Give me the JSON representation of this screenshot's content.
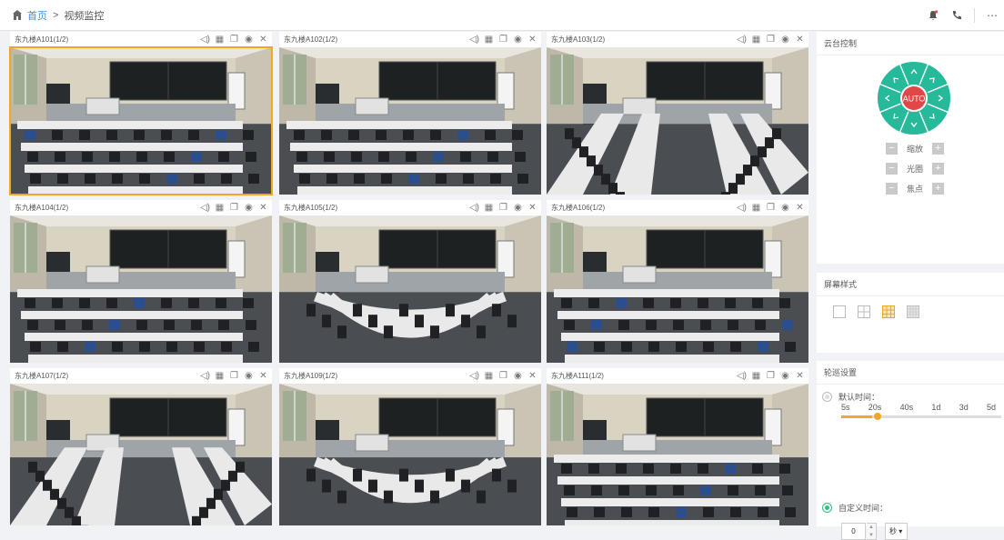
{
  "breadcrumb": {
    "home": "首页",
    "separator": ">",
    "current": "视频监控"
  },
  "topbar_icons": [
    "bell-icon",
    "phone-icon",
    "more-icon"
  ],
  "cameras": [
    {
      "name": "东九楼A101(1/2)",
      "active": true,
      "scene": "rows"
    },
    {
      "name": "东九楼A102(1/2)",
      "active": false,
      "scene": "rows"
    },
    {
      "name": "东九楼A103(1/2)",
      "active": false,
      "scene": "aisle"
    },
    {
      "name": "东九楼A104(1/2)",
      "active": false,
      "scene": "rows"
    },
    {
      "name": "东九楼A105(1/2)",
      "active": false,
      "scene": "arc"
    },
    {
      "name": "东九楼A106(1/2)",
      "active": false,
      "scene": "rows"
    },
    {
      "name": "东九楼A107(1/2)",
      "active": false,
      "scene": "aisle"
    },
    {
      "name": "东九楼A109(1/2)",
      "active": false,
      "scene": "arc"
    },
    {
      "name": "东九楼A111(1/2)",
      "active": false,
      "scene": "rows"
    }
  ],
  "cell_tool_icons": [
    "volume-icon",
    "snapshot-icon",
    "copy-icon",
    "record-icon",
    "close-icon"
  ],
  "ptz": {
    "title": "云台控制",
    "center_label": "AUTO",
    "rows": [
      {
        "label": "缩放",
        "minus": "−",
        "plus": "+"
      },
      {
        "label": "光圈",
        "minus": "−",
        "plus": "+"
      },
      {
        "label": "焦点",
        "minus": "−",
        "plus": "+"
      }
    ],
    "accent": "#26b99a",
    "center_color": "#e04848"
  },
  "layout": {
    "title": "屏幕样式",
    "options": [
      "1x1",
      "2x2",
      "3x3",
      "4x4"
    ],
    "selected": "3x3",
    "accent": "#f0a824"
  },
  "polling": {
    "title": "轮巡设置",
    "default_label": "默认时间：",
    "ticks": [
      "5s",
      "20s",
      "40s",
      "1d",
      "3d",
      "5d"
    ],
    "selected_index": 1,
    "custom_label": "自定义时间：",
    "custom_value": "0",
    "unit": "秒 ▾",
    "mode": "custom"
  }
}
